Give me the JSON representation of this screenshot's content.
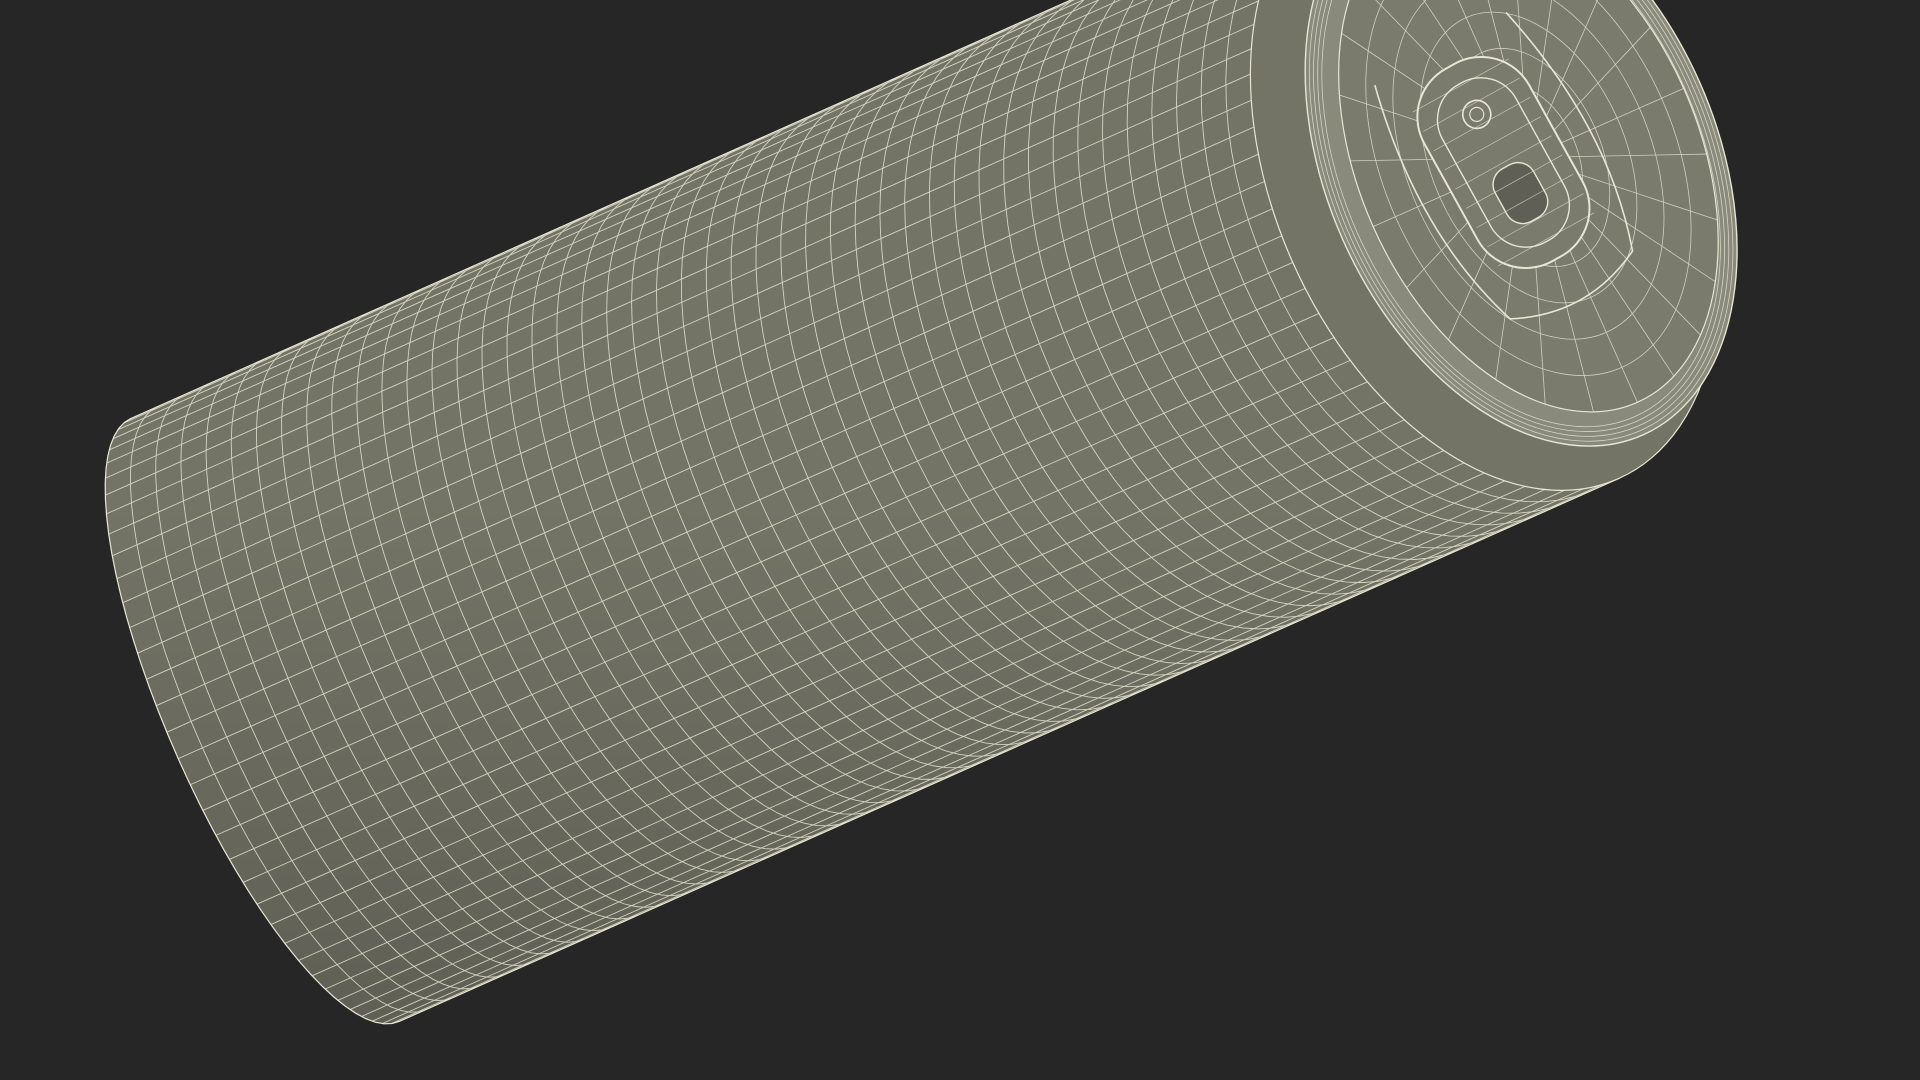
{
  "scene": {
    "subject": "beverage-can-wireframe",
    "background_color": "#262626",
    "surface_color": "#737366",
    "surface_shadow_color": "#5f5f55",
    "lid_color": "#7a7a6d",
    "wire_color": "#e6e6d2",
    "rim_color": "#8a8a7c"
  }
}
